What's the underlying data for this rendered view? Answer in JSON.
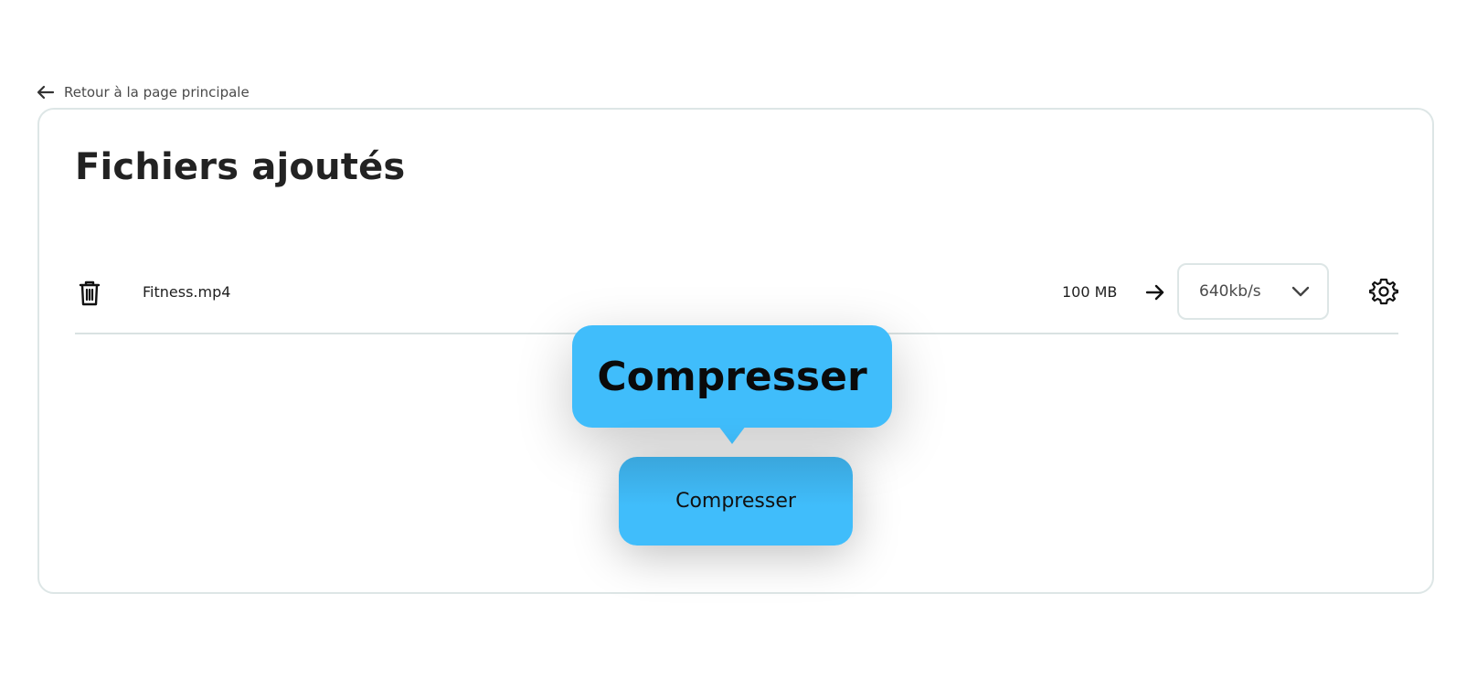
{
  "back_link": {
    "label": "Retour à la page principale",
    "icon": "arrow-left-icon"
  },
  "card": {
    "title": "Fichiers ajoutés"
  },
  "file": {
    "name": "Fitness.mp4",
    "size": "100 MB",
    "bitrate": "640kb/s",
    "icons": {
      "delete": "trash-icon",
      "convert": "arrow-right-icon",
      "dropdown": "chevron-down-icon",
      "settings": "gear-icon"
    }
  },
  "tooltip": {
    "label": "Compresser"
  },
  "action": {
    "compress_label": "Compresser"
  },
  "colors": {
    "accent": "#40bdfb",
    "border": "#dde6e6",
    "text": "#1f1f1f"
  }
}
